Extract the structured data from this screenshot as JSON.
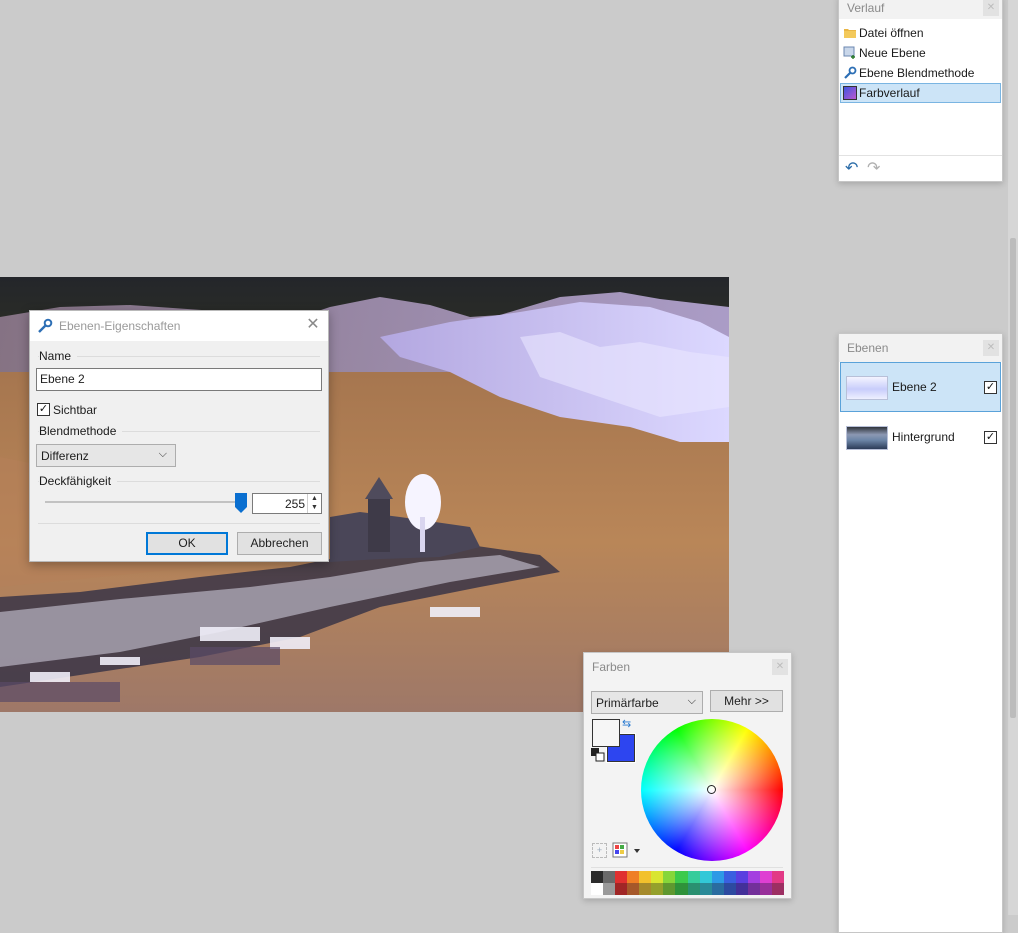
{
  "history": {
    "title": "Verlauf",
    "items": [
      {
        "label": "Datei öffnen",
        "icon": "folder-icon"
      },
      {
        "label": "Neue Ebene",
        "icon": "new-layer-icon"
      },
      {
        "label": "Ebene Blendmethode",
        "icon": "wrench-icon"
      },
      {
        "label": "Farbverlauf",
        "icon": "gradient-icon"
      }
    ],
    "selected_index": 3,
    "undo_icon": "undo-icon",
    "redo_icon": "redo-icon"
  },
  "layers": {
    "title": "Ebenen",
    "items": [
      {
        "name": "Ebene 2",
        "visible": true,
        "selected": true
      },
      {
        "name": "Hintergrund",
        "visible": true,
        "selected": false
      }
    ]
  },
  "dialog": {
    "title": "Ebenen-Eigenschaften",
    "name_label": "Name",
    "name_value": "Ebene 2",
    "visible_label": "Sichtbar",
    "visible_checked": true,
    "blend_label": "Blendmethode",
    "blend_value": "Differenz",
    "opacity_label": "Deckfähigkeit",
    "opacity_value": "255",
    "opacity_fraction": 1.0,
    "ok_label": "OK",
    "cancel_label": "Abbrechen"
  },
  "colors": {
    "title": "Farben",
    "mode_value": "Primärfarbe",
    "more_label": "Mehr >>",
    "primary_color": "#f6f6f6",
    "secondary_color": "#2d45f0",
    "palette_top": [
      "#2b2b2b",
      "#6a6a6a",
      "#e03030",
      "#ef7f25",
      "#f2c12c",
      "#d9e531",
      "#86d63a",
      "#3cca4b",
      "#35cc9b",
      "#32c8d8",
      "#2d9ae6",
      "#3a5fe0",
      "#5a3fe0",
      "#a43fe0",
      "#df3fd2",
      "#e23a86"
    ],
    "palette_bottom": [
      "#ffffff",
      "#9a9a9a",
      "#a02626",
      "#a5582a",
      "#a58a2c",
      "#94a02c",
      "#5f9830",
      "#2f923a",
      "#2a9070",
      "#2a8a98",
      "#2a6ca0",
      "#2d4aa0",
      "#433099",
      "#73309a",
      "#98309a",
      "#9c2f62"
    ]
  }
}
